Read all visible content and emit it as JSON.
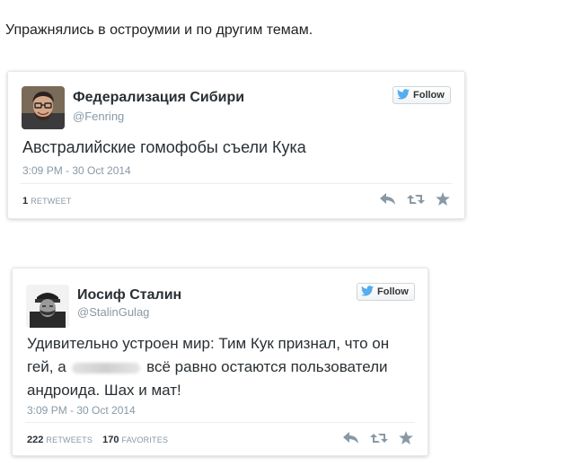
{
  "intro_text": "Упражнялись в остроумии и по другим темам.",
  "tweets": [
    {
      "name": "Федерализация Сибири",
      "handle": "@Fenring",
      "follow_label": "Follow",
      "text": "Австралийские гомофобы съели Кука",
      "date": "3:09 PM - 30 Oct 2014",
      "retweets": "1",
      "retweets_label": "RETWEET"
    },
    {
      "name": "Иосиф Сталин",
      "handle": "@StalinGulag",
      "follow_label": "Follow",
      "text_line1": "Удивительно устроен мир: Тим Кук признал, что он",
      "text_line2_a": "гей, а",
      "text_line2_b": "всё равно остаются пользователи",
      "text_line3": "андроида. Шах и мат!",
      "date": "3:09 PM - 30 Oct 2014",
      "retweets": "222",
      "retweets_label": "RETWEETS",
      "favorites": "170",
      "favorites_label": "FAVORITES"
    }
  ],
  "icons": {
    "follow": "twitter-bird-icon",
    "reply": "reply-icon",
    "retweet": "retweet-icon",
    "favorite": "star-icon"
  },
  "colors": {
    "twitter_blue": "#55acee",
    "name": "#292f33",
    "secondary": "#8899a6",
    "action_icon": "#8899a6"
  }
}
